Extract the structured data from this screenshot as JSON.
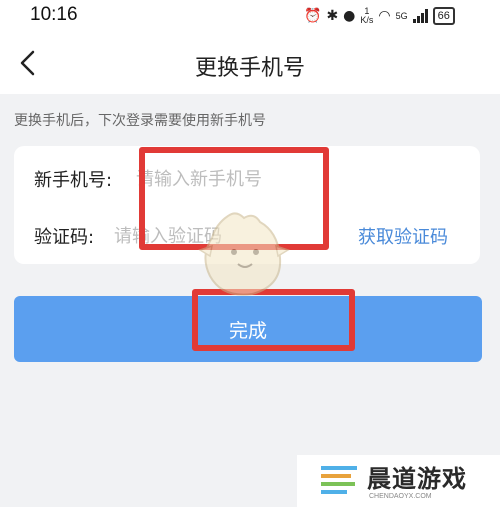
{
  "status_bar": {
    "time": "10:16",
    "network_speed_value": "1",
    "network_speed_unit": "K/s",
    "network_type": "5G",
    "battery": "66",
    "icons": [
      "alarm-icon",
      "bluetooth-icon",
      "location-icon",
      "wifi-icon",
      "signal-icon",
      "battery-icon"
    ]
  },
  "header": {
    "title": "更换手机号"
  },
  "hint": "更换手机后，下次登录需要使用新手机号",
  "form": {
    "phone_label": "新手机号:",
    "phone_placeholder": "请输入新手机号",
    "phone_value": "",
    "code_label": "验证码:",
    "code_placeholder": "请输入验证码",
    "code_value": "",
    "get_code_label": "获取验证码"
  },
  "done_label": "完成",
  "watermark": {
    "text": "晨道游戏",
    "sub": "CHENDAOYX.COM"
  },
  "colors": {
    "accent": "#5b9fef",
    "link": "#4a8ad9",
    "highlight": "#e13a36",
    "background": "#f1f2f4"
  }
}
